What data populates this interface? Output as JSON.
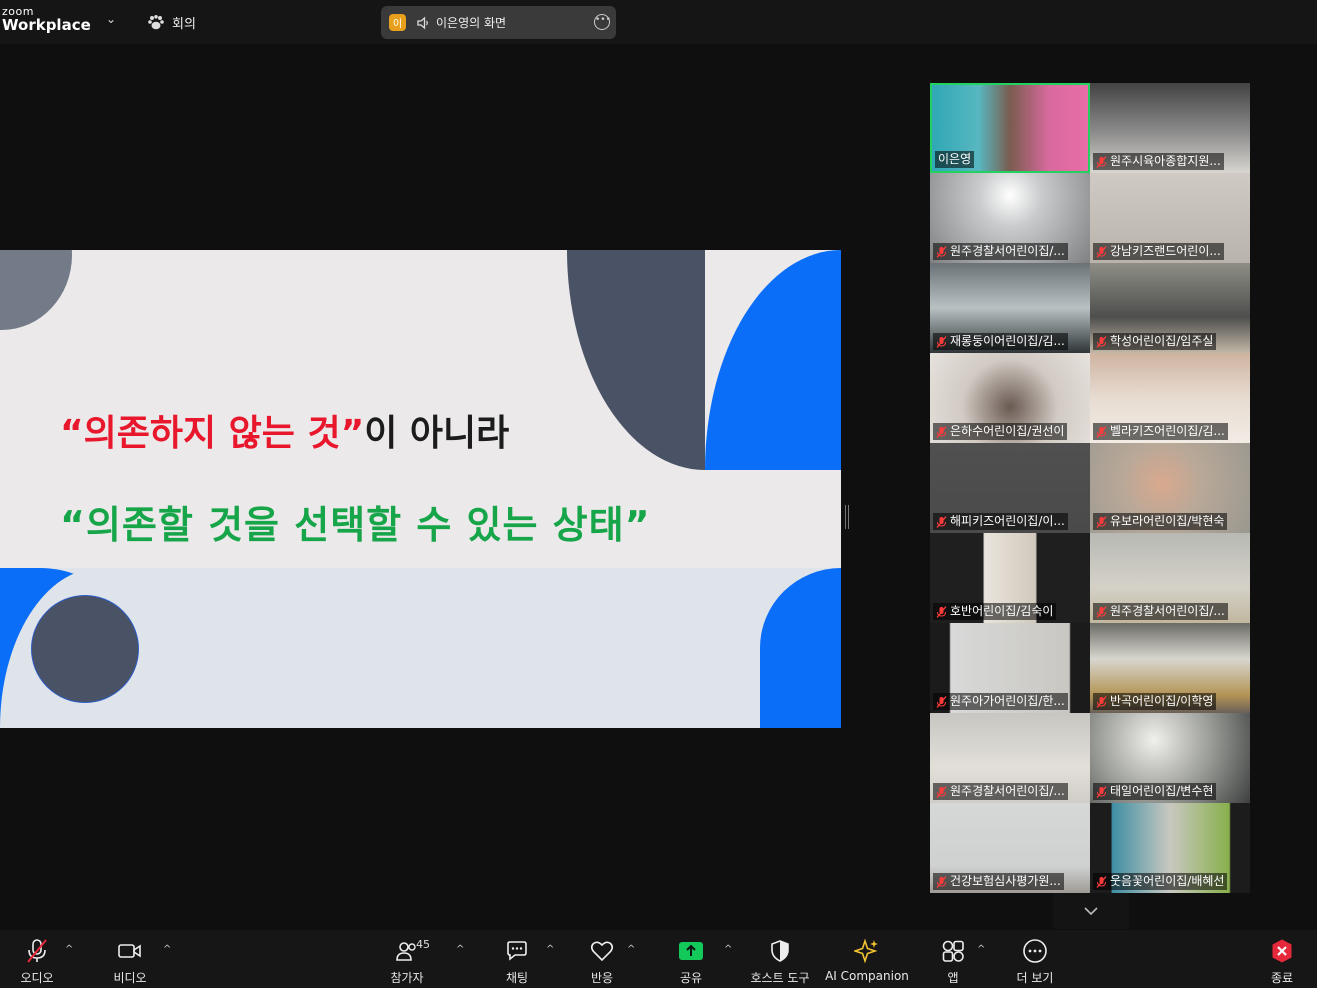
{
  "topbar": {
    "logo_top": "zoom",
    "logo_bottom": "Workplace",
    "meeting_label": "회의",
    "share_avatar_initial": "이",
    "share_label": "이은영의 화면"
  },
  "slide": {
    "line1_quote": "“의존하지 않는 것”",
    "line1_rest": "이 아니라",
    "line2": "“의존할 것을 선택할 수 있는 상태”",
    "colors": {
      "red": "#e8172c",
      "green": "#17a54a",
      "blue": "#0b6ef8",
      "slate": "#4a5266"
    }
  },
  "gallery": {
    "participants": [
      {
        "name": "이은영",
        "muted": false,
        "active": true
      },
      {
        "name": "원주시육아종합지원...",
        "muted": true
      },
      {
        "name": "원주경찰서어린이집/...",
        "muted": true
      },
      {
        "name": "강남키즈랜드어린이...",
        "muted": true
      },
      {
        "name": "재롱둥이어린이집/김...",
        "muted": true
      },
      {
        "name": "학성어린이집/임주실",
        "muted": true
      },
      {
        "name": "은하수어린이집/권선이",
        "muted": true
      },
      {
        "name": "벨라키즈어린이집/김...",
        "muted": true
      },
      {
        "name": "해피키즈어린이집/이...",
        "muted": true
      },
      {
        "name": "유보라어린이집/박현숙",
        "muted": true
      },
      {
        "name": "호반어린이집/김숙이",
        "muted": true
      },
      {
        "name": "원주경찰서어린이집/...",
        "muted": true
      },
      {
        "name": "원주아가어린이집/한...",
        "muted": true
      },
      {
        "name": "반곡어린이집/이학영",
        "muted": true
      },
      {
        "name": "원주경찰서어린이집/...",
        "muted": true
      },
      {
        "name": "태일어린이집/변수현",
        "muted": true
      },
      {
        "name": "건강보험심사평가원...",
        "muted": true
      },
      {
        "name": "웃음꽃어린이집/배혜선",
        "muted": true
      }
    ]
  },
  "toolbar": {
    "audio": "오디오",
    "video": "비디오",
    "participants": "참가자",
    "participants_count": "45",
    "chat": "채팅",
    "reactions": "반응",
    "share": "공유",
    "host_tools": "호스트 도구",
    "ai_companion": "AI Companion",
    "apps": "앱",
    "more": "더 보기",
    "end": "종료"
  }
}
